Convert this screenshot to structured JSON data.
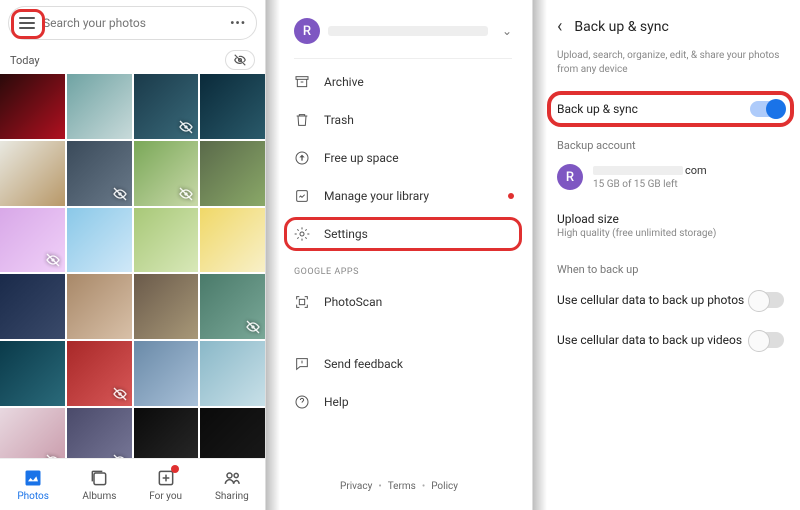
{
  "pane1": {
    "search_placeholder": "Search your photos",
    "today_label": "Today",
    "nav": {
      "photos": "Photos",
      "albums": "Albums",
      "for_you": "For you",
      "sharing": "Sharing"
    }
  },
  "pane2": {
    "avatar_letter": "R",
    "menu": {
      "archive": "Archive",
      "trash": "Trash",
      "free_up": "Free up space",
      "manage": "Manage your library",
      "settings": "Settings"
    },
    "google_apps_label": "GOOGLE APPS",
    "photoscan": "PhotoScan",
    "feedback": "Send feedback",
    "help": "Help",
    "footer": {
      "privacy": "Privacy",
      "terms": "Terms",
      "policy": "Policy"
    }
  },
  "pane3": {
    "title": "Back up & sync",
    "subtitle": "Upload, search, organize, edit, & share your photos from any device",
    "toggle_label": "Back up & sync",
    "backup_account_label": "Backup account",
    "avatar_letter": "R",
    "account_domain": "com",
    "storage": "15 GB of 15 GB left",
    "upload_size_label": "Upload size",
    "upload_size_value": "High quality (free unlimited storage)",
    "when_label": "When to back up",
    "cell_photos": "Use cellular data to back up photos",
    "cell_videos": "Use cellular data to back up videos"
  },
  "thumbs": [
    {
      "c1": "#2a0a0a",
      "c2": "#b01020",
      "icon": false
    },
    {
      "c1": "#6fa3a3",
      "c2": "#c8dada",
      "icon": false
    },
    {
      "c1": "#1a3a4a",
      "c2": "#3a6a7a",
      "icon": true
    },
    {
      "c1": "#0a2a3a",
      "c2": "#2a5a6a",
      "icon": false
    },
    {
      "c1": "#e8e8e0",
      "c2": "#b89868",
      "icon": false
    },
    {
      "c1": "#3a4a5a",
      "c2": "#6a7a8a",
      "icon": true
    },
    {
      "c1": "#7aa858",
      "c2": "#c8d8a8",
      "icon": true
    },
    {
      "c1": "#5a6a4a",
      "c2": "#8aa868",
      "icon": false
    },
    {
      "c1": "#d8a8e8",
      "c2": "#f0d0f8",
      "icon": true
    },
    {
      "c1": "#8ac8e8",
      "c2": "#d0e8f8",
      "icon": false
    },
    {
      "c1": "#a8c878",
      "c2": "#d8e8b8",
      "icon": false
    },
    {
      "c1": "#f0d868",
      "c2": "#f8f0c8",
      "icon": false
    },
    {
      "c1": "#1a2a4a",
      "c2": "#3a4a6a",
      "icon": false
    },
    {
      "c1": "#a88868",
      "c2": "#d8c0a8",
      "icon": false
    },
    {
      "c1": "#6a5a4a",
      "c2": "#a89878",
      "icon": false
    },
    {
      "c1": "#4a7a6a",
      "c2": "#7aa898",
      "icon": true
    },
    {
      "c1": "#0a3a4a",
      "c2": "#2a6a7a",
      "icon": false
    },
    {
      "c1": "#a82828",
      "c2": "#d85858",
      "icon": true
    },
    {
      "c1": "#6a8aa8",
      "c2": "#a8c0d8",
      "icon": false
    },
    {
      "c1": "#8ab8c8",
      "c2": "#c8e0e8",
      "icon": false
    },
    {
      "c1": "#e8d8e0",
      "c2": "#c898a8",
      "icon": true
    },
    {
      "c1": "#4a4a6a",
      "c2": "#7a7a9a",
      "icon": true
    },
    {
      "c1": "#0a0a0a",
      "c2": "#2a2a2a",
      "icon": false
    },
    {
      "c1": "#0a0a0a",
      "c2": "#1a1a1a",
      "icon": false
    }
  ]
}
